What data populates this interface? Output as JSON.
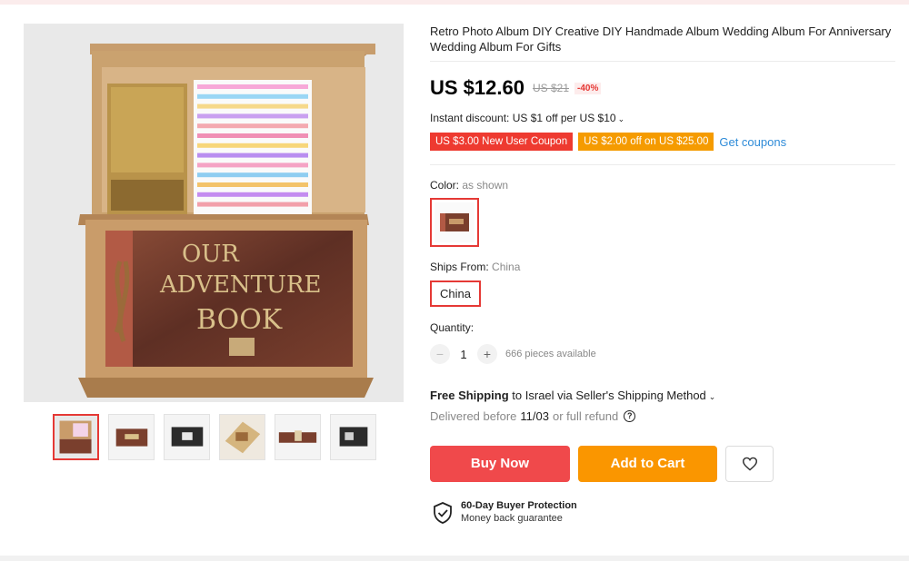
{
  "product": {
    "title": "Retro Photo Album DIY Creative DIY Handmade Album Wedding Album For Anniversary Wedding Album For Gifts",
    "price": "US $12.60",
    "old_price": "US $21",
    "discount": "-40%"
  },
  "promo": {
    "instant_discount": "Instant discount: US $1 off per US $10",
    "coupons": [
      "US $3.00 New User Coupon",
      "US $2.00 off on US $25.00"
    ],
    "get_coupons": "Get coupons"
  },
  "options": {
    "color_label": "Color:",
    "color_value": "as shown",
    "ships_from_label": "Ships From:",
    "ships_from_value": "China",
    "ships_from_option": "China"
  },
  "quantity": {
    "label": "Quantity:",
    "value": "1",
    "minus": "−",
    "plus": "+",
    "available": "666 pieces available"
  },
  "shipping": {
    "free": "Free Shipping",
    "details": "to Israel via Seller's Shipping Method",
    "delivered_prefix": "Delivered before",
    "delivered_date": "11/03",
    "delivered_suffix": "or full refund",
    "help": "?"
  },
  "actions": {
    "buy_now": "Buy Now",
    "add_to_cart": "Add to Cart"
  },
  "protection": {
    "title": "60-Day Buyer Protection",
    "subtitle": "Money back guarantee"
  },
  "image": {
    "book_line1": "OUR",
    "book_line2": "ADVENTURE",
    "book_line3": "BOOK"
  },
  "colors": {
    "accent_red": "#e53935",
    "buy_now": "#f0494b",
    "add_to_cart": "#fa9600",
    "coupon_red": "#ee3a30",
    "coupon_orange": "#f59b00",
    "link_blue": "#2e8bd8"
  },
  "icons": {
    "wishlist": "heart-icon",
    "protection": "shield-check-icon",
    "help": "question-circle-icon",
    "dropdown": "chevron-down-icon"
  }
}
